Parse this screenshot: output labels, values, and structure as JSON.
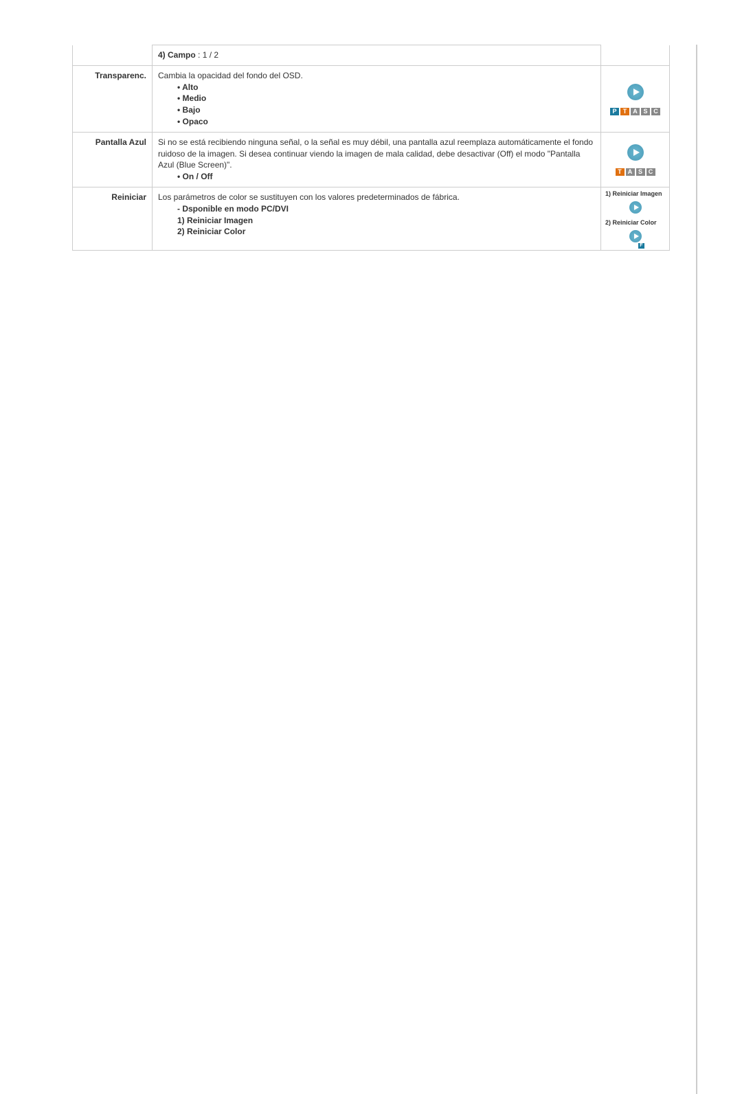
{
  "rows": {
    "campo": {
      "label_prefix": "4) Campo",
      "label_value": " : 1 / 2"
    },
    "transparenc": {
      "label": "Transparenc.",
      "desc": "Cambia la opacidad del fondo del OSD.",
      "options": [
        "Alto",
        "Medio",
        "Bajo",
        "Opaco"
      ],
      "tags": [
        "P",
        "T",
        "A",
        "S",
        "C"
      ]
    },
    "pantalla": {
      "label": "Pantalla Azul",
      "desc": "Si no se está recibiendo ninguna señal, o la señal es muy débil, una pantalla azul reemplaza automáticamente el fondo ruidoso de la imagen. Si desea continuar viendo la imagen de mala calidad, debe desactivar (Off) el modo \"Pantalla Azul (Blue Screen)\".",
      "option_line": "On / Off",
      "tags": [
        "T",
        "A",
        "S",
        "C"
      ]
    },
    "reiniciar": {
      "label": "Reiniciar",
      "desc": "Los parámetros de color se sustituyen con los valores predeterminados de fábrica.",
      "note": "- Dsponible en modo PC/DVI",
      "item1": "1) Reiniciar Imagen",
      "item2": "2) Reiniciar Color",
      "side1": "1) Reiniciar Imagen",
      "side2": "2) Reiniciar Color",
      "corner": "F"
    }
  }
}
